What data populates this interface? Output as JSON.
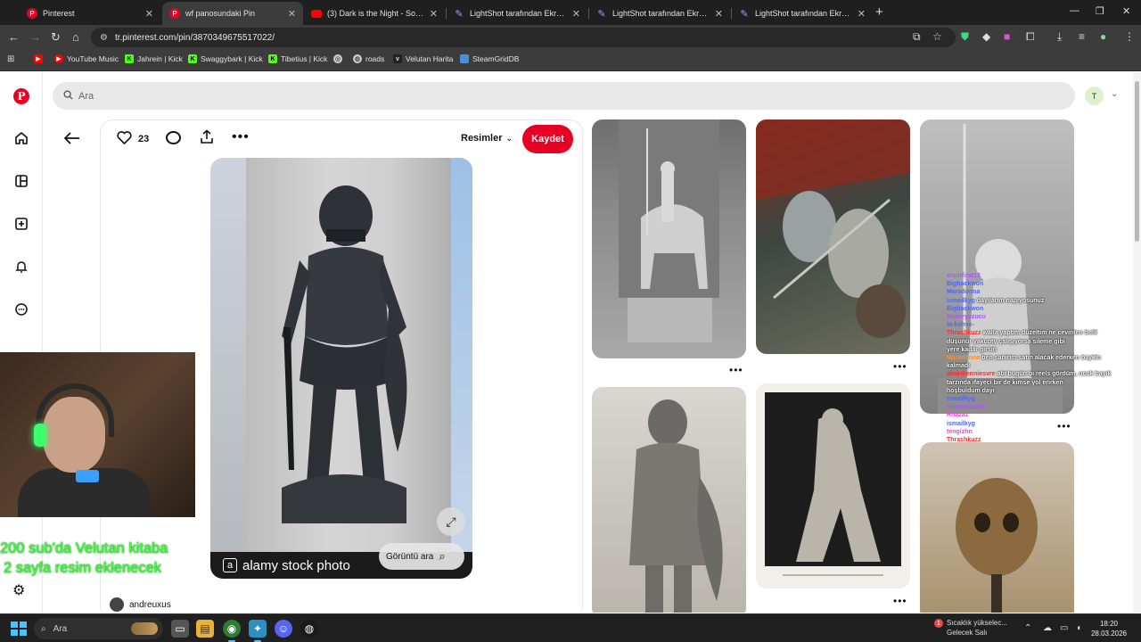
{
  "browser": {
    "tabs": [
      {
        "title": "Pinterest",
        "icon": "pinterest-icon"
      },
      {
        "title": "wf panosundaki Pin",
        "icon": "pinterest-icon",
        "active": true
      },
      {
        "title": "(3) Dark is the Night - Soviet W",
        "icon": "youtube-icon"
      },
      {
        "title": "LightShot tarafından Ekran Görü",
        "icon": "lightshot-icon"
      },
      {
        "title": "LightShot tarafından Ekran Görü",
        "icon": "lightshot-icon"
      },
      {
        "title": "LightShot tarafından Ekran Görü",
        "icon": "lightshot-icon"
      }
    ],
    "new_tab": "+",
    "url": "tr.pinterest.com/pin/3870349675517022/",
    "bookmarks": [
      {
        "label": "YouTube Music",
        "color": "#ff0000"
      },
      {
        "label": "Jahrein | Kick",
        "color": "#53fc18"
      },
      {
        "label": "Swaggybark | Kick",
        "color": "#53fc18"
      },
      {
        "label": "Tibetius | Kick",
        "color": "#53fc18"
      },
      {
        "label": "roads",
        "color": "#cccccc"
      },
      {
        "label": "Velutan Harita",
        "color": "#333333"
      },
      {
        "label": "SteamGridDB",
        "color": "#4a90d9"
      }
    ]
  },
  "pinterest": {
    "search_placeholder": "Ara",
    "avatar_letter": "T",
    "pin": {
      "like_count": "23",
      "board_dropdown": "Resimler",
      "save_label": "Kaydet",
      "watermark_text": "alamy stock photo",
      "visual_search_label": "Görüntü ara",
      "creator": "andreuxus"
    }
  },
  "overlay": {
    "sub_goal_line1": "200 sub'da Velutan kitaba",
    "sub_goal_line2": "2 sayfa resim eklenecek",
    "chat": [
      {
        "user": "ersinfirat13",
        "msg": ""
      },
      {
        "user": "Bigbackwon",
        "msg": ""
      },
      {
        "user": "Maradonna",
        "msg": ""
      },
      {
        "user": "ismailkyg",
        "msg": "dayılarım napıyosunuz"
      },
      {
        "user": "Bigbackwon",
        "msg": ""
      },
      {
        "user": "Superyuzucu",
        "msg": ""
      },
      {
        "user": "lo-kahve-",
        "msg": ""
      },
      {
        "user": "Thrashkuzz",
        "msg": "walla yaptım düzeltim ne cevirilen belli"
      },
      {
        "user": "",
        "msg": "düşünür yakupty çalışıyorsa sileme gibi"
      },
      {
        "user": "",
        "msg": "yere kadar girsin"
      },
      {
        "user": "Maradonna",
        "msg": "ben sanirim satın alacak ederken baykin"
      },
      {
        "user": "",
        "msg": "kalmadı"
      },
      {
        "user": "akakihenniesvre",
        "msg": "abi bugün bi reels gördüm, ucuk bayık"
      },
      {
        "user": "",
        "msg": "tarzında ifayeci bir de kimse yol erirken"
      },
      {
        "user": "",
        "msg": "hoşbuldum dayı"
      },
      {
        "user": "ismailkyg",
        "msg": ""
      },
      {
        "user": "Superyuzucu",
        "msg": ""
      },
      {
        "user": "Rhazaz",
        "msg": ""
      },
      {
        "user": "ismailkyg",
        "msg": ""
      },
      {
        "user": "tengizhn",
        "msg": ""
      },
      {
        "user": "Thrashkuzz",
        "msg": ""
      }
    ]
  },
  "taskbar": {
    "search_label": "Ara",
    "weather_line1": "Sıcaklık yükselec...",
    "weather_line2": "Gelecek Salı",
    "weather_badge": "1",
    "time": "18:20",
    "date": "28.03.2026"
  },
  "colors": {
    "pinterest_red": "#e60023",
    "sub_goal_green": "#3cff3c",
    "chrome_dark": "#3c3c3c"
  }
}
